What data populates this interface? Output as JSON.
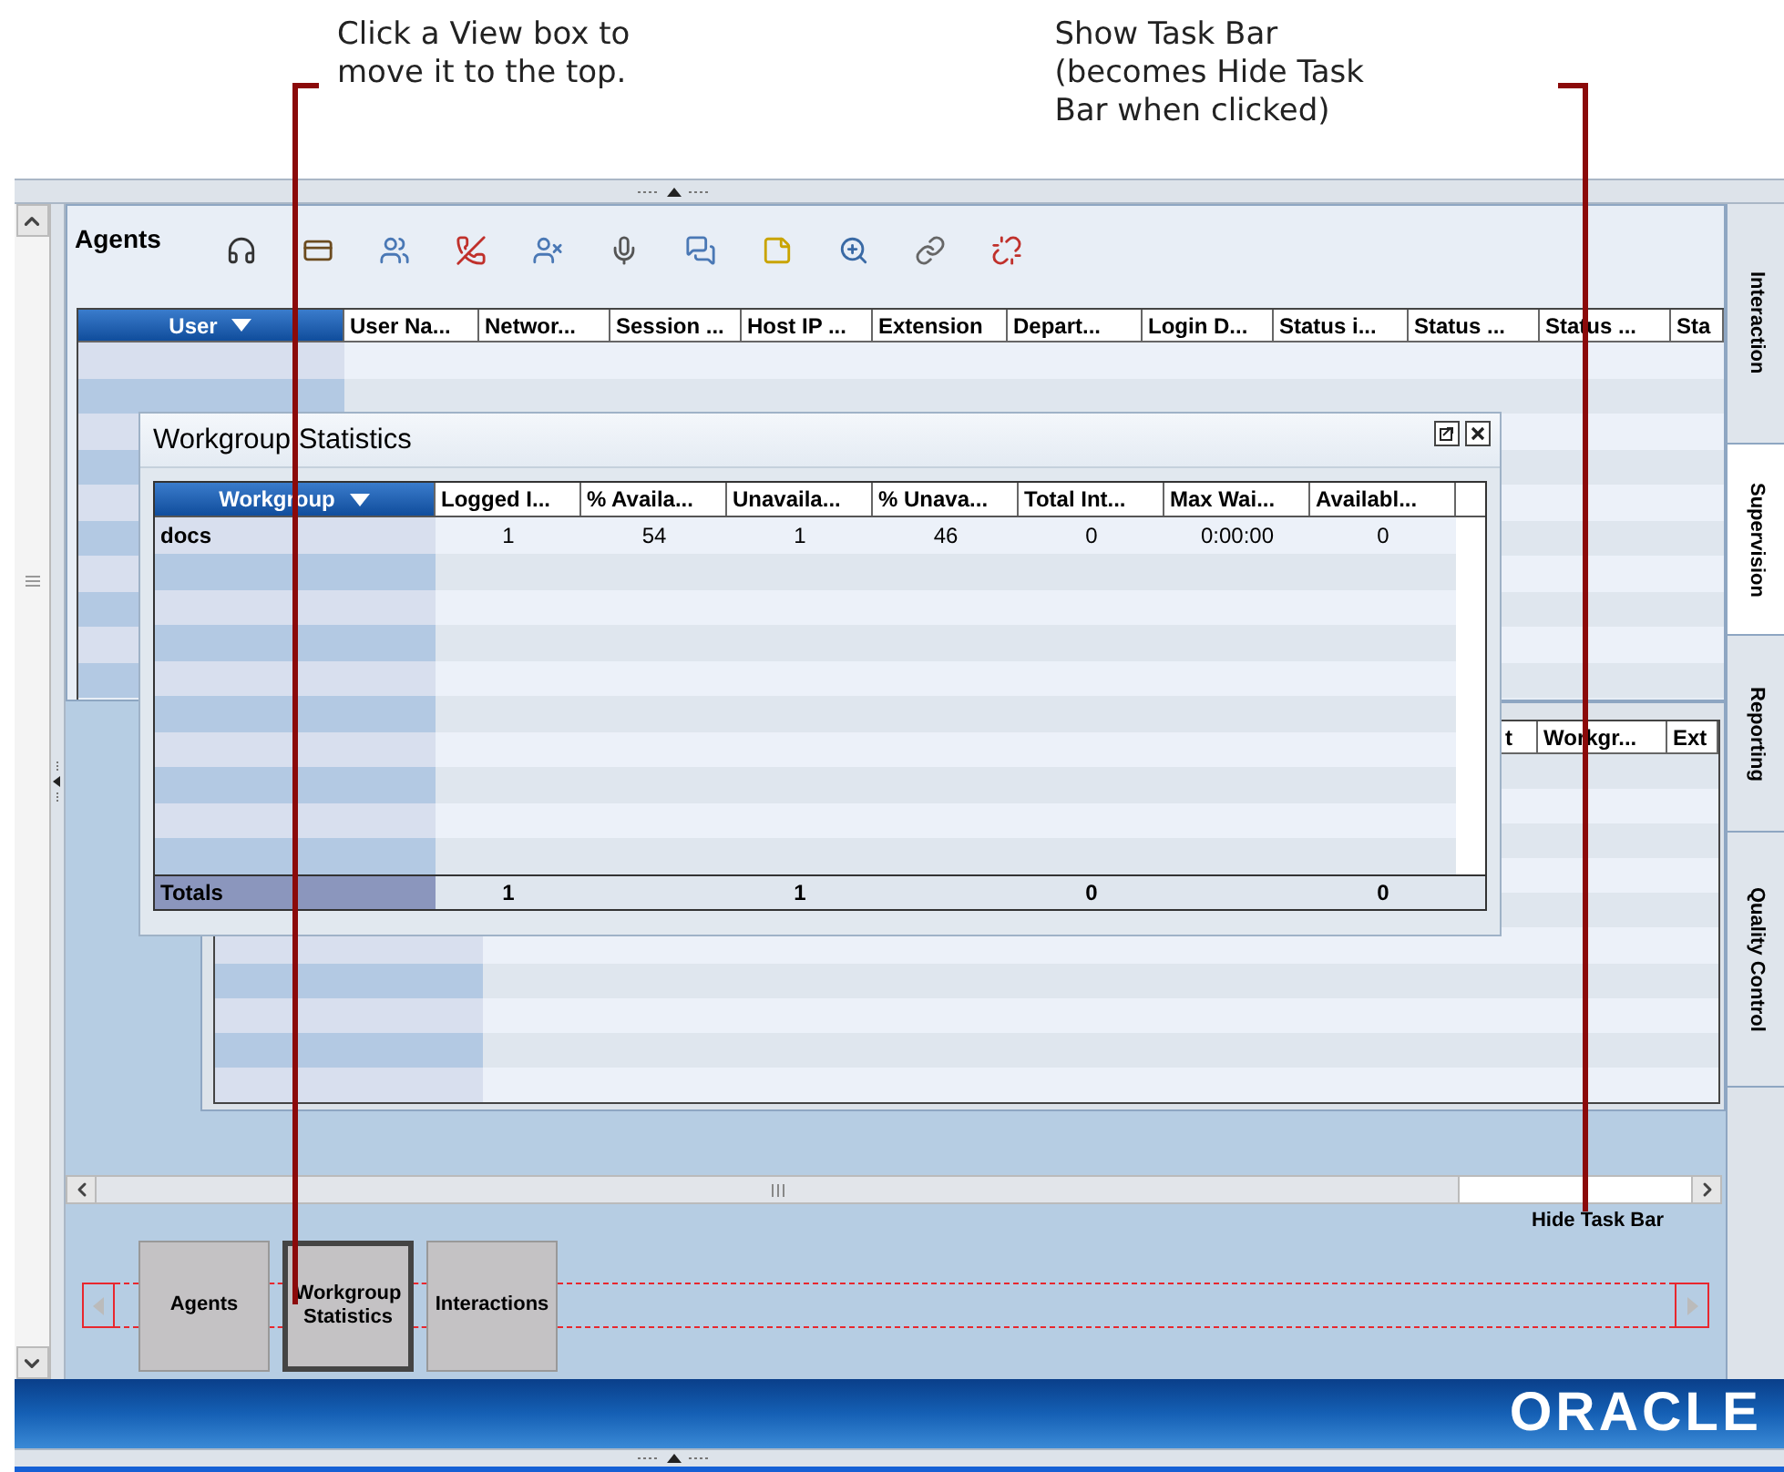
{
  "annotations": [
    {
      "lines": [
        "Click a View box to",
        "move it to the top."
      ]
    },
    {
      "lines": [
        "Show Task Bar",
        "(becomes Hide Task",
        "Bar when clicked)"
      ]
    }
  ],
  "agents_panel": {
    "title": "Agents",
    "columns": [
      {
        "label": "User",
        "sorted": true
      },
      {
        "label": "User Na...",
        "sorted": false
      },
      {
        "label": "Networ...",
        "sorted": false
      },
      {
        "label": "Session ...",
        "sorted": false
      },
      {
        "label": "Host IP ...",
        "sorted": false
      },
      {
        "label": "Extension",
        "sorted": false
      },
      {
        "label": "Depart...",
        "sorted": false
      },
      {
        "label": "Login D...",
        "sorted": false
      },
      {
        "label": "Status i...",
        "sorted": false
      },
      {
        "label": "Status ...",
        "sorted": false
      },
      {
        "label": "Status ...",
        "sorted": false
      },
      {
        "label": "Sta",
        "sorted": false
      }
    ]
  },
  "workgroup_window": {
    "title": "Workgroup Statistics",
    "totals_label": "Totals",
    "columns": [
      {
        "label": "Workgroup",
        "sorted": true
      },
      {
        "label": "Logged I...",
        "sorted": false,
        "total": "1"
      },
      {
        "label": "% Availa...",
        "sorted": false
      },
      {
        "label": "Unavaila...",
        "sorted": false,
        "total": "1"
      },
      {
        "label": "% Unava...",
        "sorted": false
      },
      {
        "label": "Total Int...",
        "sorted": false,
        "total": "0"
      },
      {
        "label": "Max Wai...",
        "sorted": false
      },
      {
        "label": "Availabl...",
        "sorted": false,
        "total": "0"
      }
    ],
    "rows": [
      {
        "workgroup": "docs",
        "values": [
          "1",
          "54",
          "1",
          "46",
          "0",
          "0:00:00",
          "0"
        ]
      }
    ]
  },
  "interactions_panel": {
    "columns": [
      "t",
      "Workgr...",
      "Ext"
    ]
  },
  "side_tabs": [
    {
      "label": "Interaction",
      "selected": false
    },
    {
      "label": "Supervision",
      "selected": true
    },
    {
      "label": "Reporting",
      "selected": false
    },
    {
      "label": "Quality Control",
      "selected": false
    }
  ],
  "task_bar": {
    "toggle_label": "Hide Task Bar",
    "views": [
      {
        "label": "Agents",
        "selected": false
      },
      {
        "label": "Workgroup Statistics",
        "selected": true
      },
      {
        "label": "Interactions",
        "selected": false
      }
    ]
  },
  "footer": {
    "logo": "ORACLE"
  }
}
